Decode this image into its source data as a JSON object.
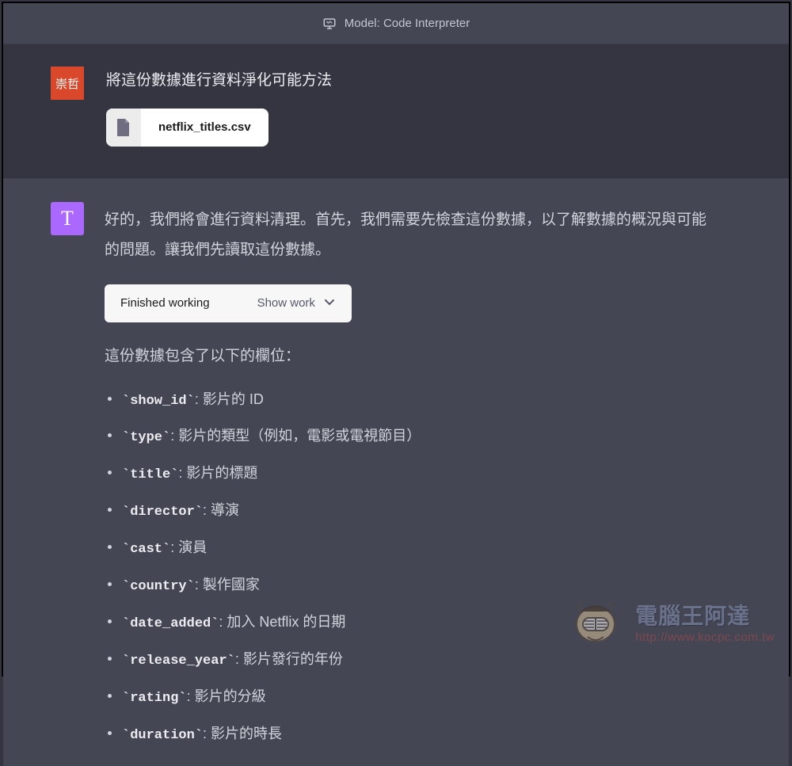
{
  "header": {
    "model_label": "Model: Code Interpreter"
  },
  "user": {
    "avatar_text": "崇哲",
    "prompt": "將這份數據進行資料淨化可能方法",
    "attachment": {
      "filename": "netflix_titles.csv"
    }
  },
  "assistant": {
    "avatar_text": "T",
    "intro": "好的，我們將會進行資料清理。首先，我們需要先檢查這份數據，以了解數據的概況與可能的問題。讓我們先讀取這份數據。",
    "work_pill": {
      "status": "Finished working",
      "toggle": "Show work"
    },
    "columns_intro": "這份數據包含了以下的欄位：",
    "fields": [
      {
        "name": "show_id",
        "desc": ": 影片的 ID"
      },
      {
        "name": "type",
        "desc": ": 影片的類型（例如，電影或電視節目）"
      },
      {
        "name": "title",
        "desc": ": 影片的標題"
      },
      {
        "name": "director",
        "desc": ": 導演"
      },
      {
        "name": "cast",
        "desc": ": 演員"
      },
      {
        "name": "country",
        "desc": ": 製作國家"
      },
      {
        "name": "date_added",
        "desc": ": 加入 Netflix 的日期"
      },
      {
        "name": "release_year",
        "desc": ": 影片發行的年份"
      },
      {
        "name": "rating",
        "desc": ": 影片的分級"
      },
      {
        "name": "duration",
        "desc": ": 影片的時長"
      }
    ]
  },
  "watermark": {
    "brand_name": "電腦王阿達",
    "brand_url": "http://www.kocpc.com.tw"
  }
}
